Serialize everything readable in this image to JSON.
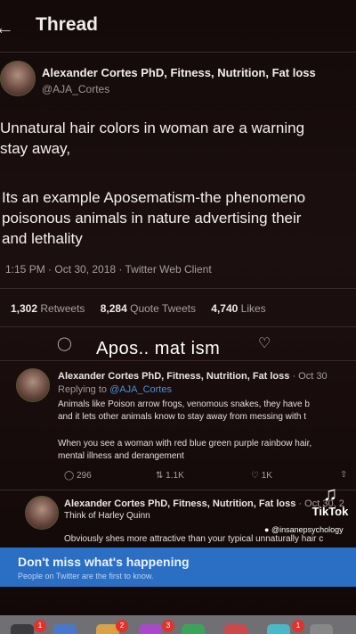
{
  "header": {
    "back_icon": "arrow-left-icon",
    "title": "Thread"
  },
  "tweet": {
    "author_name": "Alexander Cortes PhD, Fitness, Nutrition, Fat loss",
    "author_handle": "@AJA_Cortes",
    "text_p1": "Unnatural hair colors in woman are a warning\nstay away,",
    "text_p2": "Its an example Aposematism-the phenomeno\npoisonous animals in nature advertising their\nand lethality",
    "meta": "1:15 PM · Oct 30, 2018 · Twitter Web Client",
    "stats": {
      "retweets_count": "1,302",
      "retweets_label": "Retweets",
      "quotes_count": "8,284",
      "quotes_label": "Quote Tweets",
      "likes_count": "4,740",
      "likes_label": "Likes"
    }
  },
  "overlay_caption": "Apos.. mat  ism",
  "replies": [
    {
      "author_name": "Alexander Cortes PhD, Fitness, Nutrition, Fat loss",
      "time_suffix": "· Oct 30",
      "replying_prefix": "Replying to",
      "replying_to": "@AJA_Cortes",
      "body_p1": "Animals like Poison arrow frogs, venomous snakes, they have b\nand it lets other animals know to stay away from messing with t",
      "body_p2": "When you see a woman with red blue green purple rainbow hair,\nmental illness and derangement",
      "replies_count": "296",
      "retweets_count": "1.1K",
      "likes_count": "1K"
    },
    {
      "author_name": "Alexander Cortes PhD, Fitness, Nutrition, Fat loss",
      "time_suffix": "· Oct 30, 2",
      "subline": "Think of Harley Quinn",
      "body": "Obviously shes more attractive than your typical unnaturally hair c"
    }
  ],
  "watermark": {
    "brand": "TikTok",
    "username": "@insanepsychology"
  },
  "banner": {
    "title": "Don't miss what's happening",
    "subtitle": "People on Twitter are the first to know."
  },
  "dock_badges": [
    "1",
    "2",
    "3",
    "1"
  ]
}
